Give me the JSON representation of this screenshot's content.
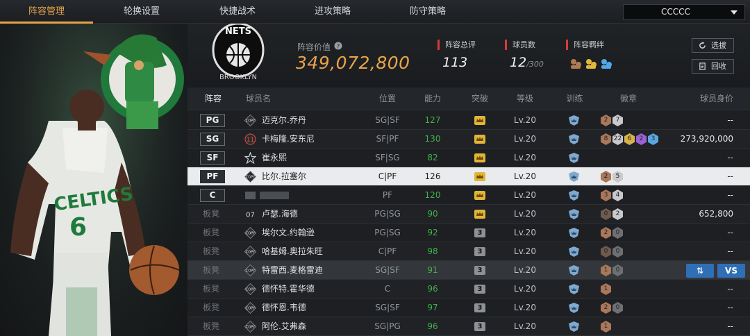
{
  "nav": {
    "tabs": [
      "阵容管理",
      "轮换设置",
      "快捷战术",
      "进攻策略",
      "防守策略"
    ],
    "team_select": "CCCCC"
  },
  "header": {
    "team_logo_text": "NETS",
    "lineup_value_label": "阵容价值",
    "lineup_value": "349,072,800",
    "rating_label": "阵容总评",
    "rating": "113",
    "player_count_label": "球员数",
    "player_count": "12",
    "player_count_max": "/300",
    "bond_label": "阵容羁绊",
    "select_btn": "选拔",
    "recycle_btn": "回收"
  },
  "table": {
    "headers": [
      "阵容",
      "球员名",
      "位置",
      "能力",
      "突破",
      "等级",
      "训练",
      "徽章",
      "球员身价"
    ],
    "rows": [
      {
        "slot": "PG",
        "starter": true,
        "icon": "COPY",
        "name": "迈克尔.乔丹",
        "pos": "SG|SF",
        "ability": "127",
        "break": "gold",
        "level": "Lv.20",
        "badges": [
          {
            "t": "2",
            "c": "#a9775a"
          },
          {
            "t": "7",
            "c": "#c7c9cc"
          }
        ],
        "value": "--"
      },
      {
        "slot": "SG",
        "starter": true,
        "icon": "11",
        "name": "卡梅隆.安东尼",
        "pos": "SF|PF",
        "ability": "130",
        "break": "gold",
        "level": "Lv.20",
        "badges": [
          {
            "t": "8",
            "c": "#a9775a"
          },
          {
            "t": "22",
            "c": "#c7c9cc"
          },
          {
            "t": "6",
            "c": "#d8b24a"
          },
          {
            "t": "2",
            "c": "#9a62d6"
          },
          {
            "t": "3",
            "c": "#5aa7e0"
          }
        ],
        "value": "273,920,000"
      },
      {
        "slot": "SF",
        "starter": true,
        "icon": "star",
        "name": "崔永熙",
        "pos": "SF|SG",
        "ability": "82",
        "break": "gold",
        "level": "Lv.20",
        "badges": [],
        "value": "--"
      },
      {
        "slot": "PF",
        "starter": true,
        "icon": "COPY",
        "name": "比尔.拉塞尔",
        "pos": "C|PF",
        "ability": "126",
        "break": "gold",
        "level": "Lv.20",
        "badges": [
          {
            "t": "2",
            "c": "#a9775a"
          },
          {
            "t": "5",
            "c": "#c7c9cc"
          }
        ],
        "value": "--"
      },
      {
        "slot": "C",
        "starter": true,
        "icon": "blur",
        "name": "",
        "pos": "PF",
        "ability": "120",
        "break": "gold",
        "level": "Lv.20",
        "badges": [
          {
            "t": "3",
            "c": "#a9775a"
          },
          {
            "t": "4",
            "c": "#c7c9cc"
          }
        ],
        "value": "--"
      },
      {
        "slot": "板凳",
        "starter": false,
        "icon": "07",
        "name": "卢瑟.海德",
        "pos": "PG|SG",
        "ability": "90",
        "break": "gold",
        "level": "Lv.20",
        "badges": [
          {
            "t": "0",
            "c": "#6f5a4c"
          },
          {
            "t": "2",
            "c": "#c7c9cc"
          }
        ],
        "value": "652,800"
      },
      {
        "slot": "板凳",
        "starter": false,
        "icon": "COPY",
        "name": "埃尔文.约翰逊",
        "pos": "PG|SG",
        "ability": "92",
        "break": "3",
        "level": "Lv.20",
        "badges": [
          {
            "t": "2",
            "c": "#a9775a"
          },
          {
            "t": "0",
            "c": "#6d6f72"
          }
        ],
        "value": "--"
      },
      {
        "slot": "板凳",
        "starter": false,
        "icon": "COPY",
        "name": "哈基姆.奥拉朱旺",
        "pos": "C|PF",
        "ability": "98",
        "break": "3",
        "level": "Lv.20",
        "badges": [
          {
            "t": "0",
            "c": "#6f5a4c"
          },
          {
            "t": "0",
            "c": "#6d6f72"
          }
        ],
        "value": "--"
      },
      {
        "slot": "板凳",
        "starter": false,
        "icon": "COPY",
        "name": "特雷西.麦格雷迪",
        "pos": "SG|SF",
        "ability": "91",
        "break": "3",
        "level": "Lv.20",
        "badges": [
          {
            "t": "1",
            "c": "#a9775a"
          },
          {
            "t": "0",
            "c": "#6d6f72"
          }
        ],
        "value": "",
        "buttons": [
          "⇅",
          "VS"
        ]
      },
      {
        "slot": "板凳",
        "starter": false,
        "icon": "COPY",
        "name": "德怀特.霍华德",
        "pos": "C",
        "ability": "96",
        "break": "3",
        "level": "Lv.20",
        "badges": [
          {
            "t": "1",
            "c": "#a9775a"
          }
        ],
        "value": "--"
      },
      {
        "slot": "板凳",
        "starter": false,
        "icon": "COPY",
        "name": "德怀恩.韦德",
        "pos": "SG|SF",
        "ability": "97",
        "break": "3",
        "level": "Lv.20",
        "badges": [
          {
            "t": "2",
            "c": "#a9775a"
          },
          {
            "t": "0",
            "c": "#6d6f72"
          }
        ],
        "value": "--"
      },
      {
        "slot": "板凳",
        "starter": false,
        "icon": "COPY",
        "name": "阿伦.艾弗森",
        "pos": "SG|PG",
        "ability": "96",
        "break": "3",
        "level": "Lv.20",
        "badges": [
          {
            "t": "1",
            "c": "#a9775a"
          }
        ],
        "value": "--"
      }
    ]
  },
  "colors": {
    "accent": "#e8a44a",
    "ability_green": "#43b049",
    "highlight_row": "#e9ebed",
    "button_blue": "#2f6fb5",
    "stat_red": "#d73a3a"
  }
}
